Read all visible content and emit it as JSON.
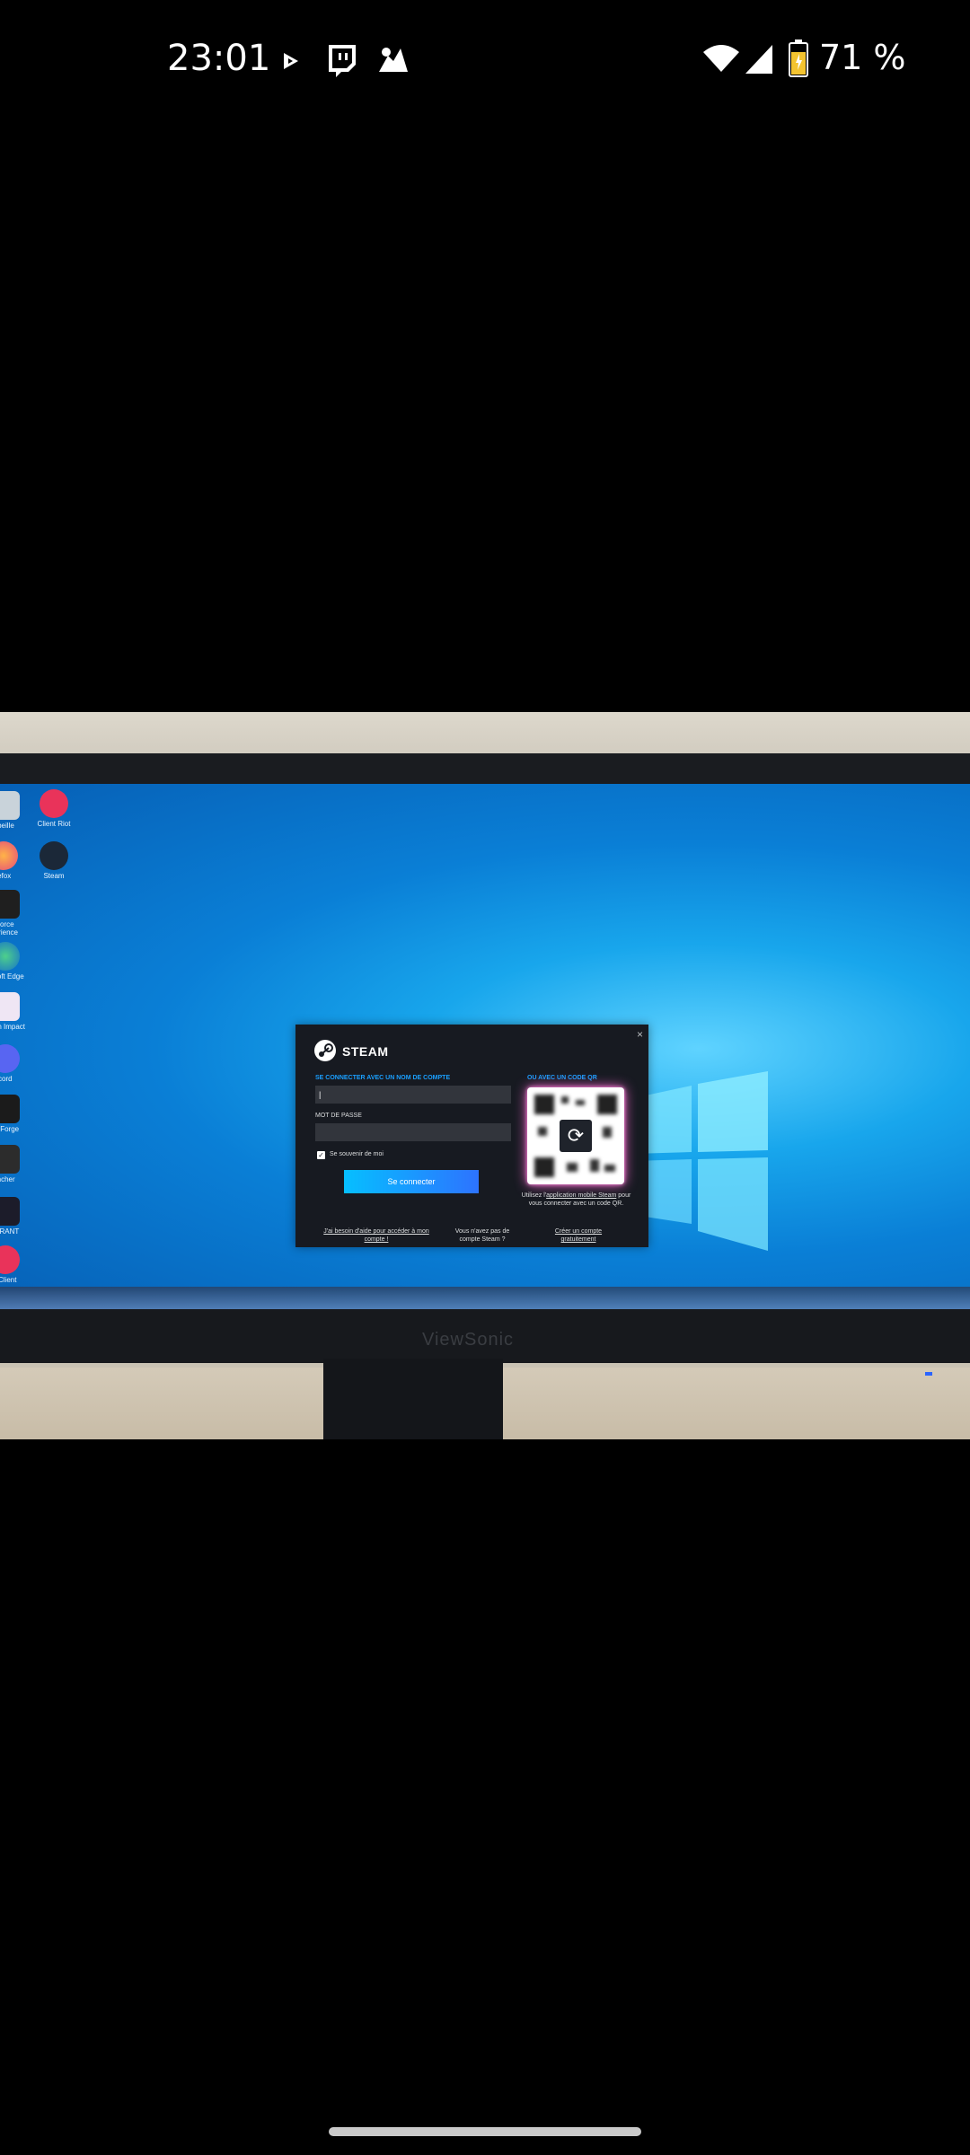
{
  "status_bar": {
    "time": "23:01",
    "battery_percent": "71 %",
    "icons": [
      "play-icon",
      "twitch-icon",
      "notification-icon",
      "wifi-icon",
      "signal-icon",
      "battery-icon"
    ]
  },
  "desktop": {
    "icons": [
      {
        "label": "Corbeille"
      },
      {
        "label": "Client Riot"
      },
      {
        "label": "Firefox"
      },
      {
        "label": "Steam"
      },
      {
        "label": "GeForce Experience"
      },
      {
        "label": "Microsoft Edge"
      },
      {
        "label": "Genshin Impact"
      },
      {
        "label": "Discord"
      },
      {
        "label": "CurseForge"
      },
      {
        "label": "Launcher"
      },
      {
        "label": "VALORANT"
      },
      {
        "label": "Riot Client"
      }
    ],
    "monitor_brand": "ViewSonic"
  },
  "steam_dialog": {
    "title": "STEAM",
    "close_glyph": "×",
    "username_section_label": "SE CONNECTER AVEC UN NOM DE COMPTE",
    "qr_section_label": "OU AVEC UN CODE QR",
    "password_label": "MOT DE PASSE",
    "username_value": "|",
    "remember_me_label": "Se souvenir de moi",
    "login_button": "Se connecter",
    "qr_help_prefix": "Utilisez l'",
    "qr_help_link": "application mobile Steam",
    "qr_help_suffix": "pour vous connecter avec un code QR.",
    "help_link": "J'ai besoin d'aide pour accéder à mon compte !",
    "no_account_text": "Vous n'avez pas de compte Steam ?",
    "create_account_link": "Créer un compte gratuitement",
    "accent_color": "#1a9fff"
  }
}
